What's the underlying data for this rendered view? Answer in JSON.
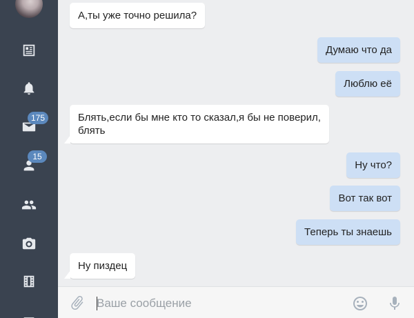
{
  "sidebar": {
    "items": [
      {
        "name": "news",
        "icon": "newspaper-icon"
      },
      {
        "name": "notifications",
        "icon": "bell-icon"
      },
      {
        "name": "messages",
        "icon": "envelope-icon",
        "badge": "175"
      },
      {
        "name": "friends",
        "icon": "person-icon",
        "badge": "15"
      },
      {
        "name": "groups",
        "icon": "group-icon"
      },
      {
        "name": "photos",
        "icon": "camera-icon"
      },
      {
        "name": "videos",
        "icon": "film-icon"
      }
    ]
  },
  "messages": [
    {
      "direction": "in",
      "text": "А,ты уже точно решила?"
    },
    {
      "direction": "out",
      "text": "Думаю что да"
    },
    {
      "direction": "out",
      "text": "Люблю её"
    },
    {
      "direction": "in",
      "text": "Блять,если бы мне кто то сказал,я бы не поверил,\nблять"
    },
    {
      "direction": "out",
      "text": "Ну что?"
    },
    {
      "direction": "out",
      "text": "Вот так вот"
    },
    {
      "direction": "out",
      "text": "Теперь ты знаешь"
    },
    {
      "direction": "in",
      "text": "Ну пиздец"
    }
  ],
  "composer": {
    "placeholder": "Ваше сообщение",
    "value": ""
  },
  "colors": {
    "sidebar_bg": "#3a4350",
    "chat_bg": "#edeef0",
    "incoming_bubble": "#ffffff",
    "outgoing_bubble": "#cddff5",
    "badge": "#5b88bd"
  }
}
